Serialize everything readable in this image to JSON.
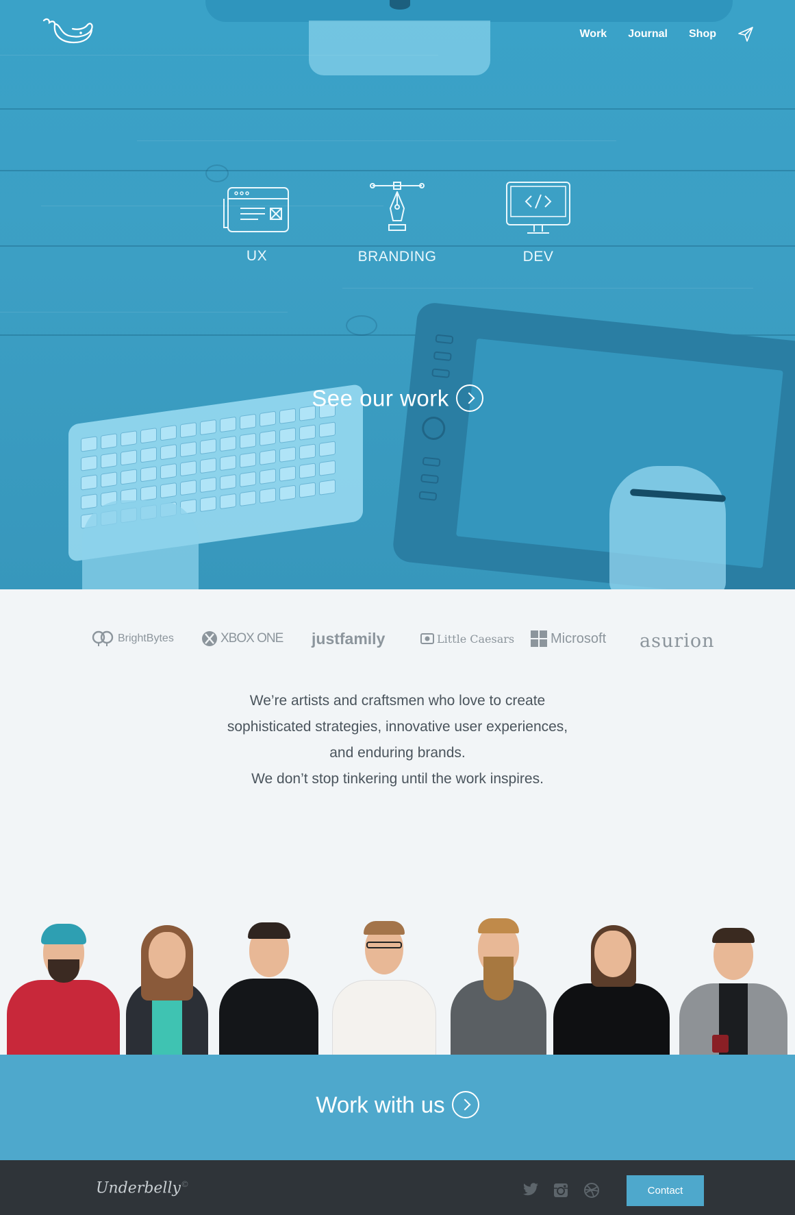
{
  "nav": {
    "logo": "whale-logo",
    "links": [
      "Work",
      "Journal",
      "Shop"
    ],
    "send_icon": "paper-plane-icon"
  },
  "services": [
    {
      "label": "UX",
      "icon": "browser-window-icon"
    },
    {
      "label": "BRANDING",
      "icon": "pen-tool-icon"
    },
    {
      "label": "DEV",
      "icon": "code-monitor-icon"
    }
  ],
  "hero_cta": {
    "label": "See our work",
    "icon": "chevron-circle-right-icon"
  },
  "clients": [
    "BrightBytes",
    "XBOX ONE",
    "justfamily",
    "Little Caesars",
    "Microsoft",
    "asurion"
  ],
  "about": {
    "lines": [
      "We’re artists and craftsmen who love to create",
      "sophisticated strategies, innovative user experiences,",
      "and enduring brands.",
      "We don’t stop tinkering until the work inspires."
    ]
  },
  "team_count": 7,
  "work_cta": {
    "label": "Work with us",
    "icon": "chevron-circle-right-icon"
  },
  "footer": {
    "brand": "Underbelly",
    "brand_mark": "©",
    "social": [
      "twitter-icon",
      "instagram-icon",
      "dribbble-icon"
    ],
    "contact_label": "Contact"
  },
  "colors": {
    "hero_blue": "#3ca0c6",
    "accent": "#4ea8cc",
    "footer": "#2f3439",
    "light_bg": "#f2f5f7"
  }
}
